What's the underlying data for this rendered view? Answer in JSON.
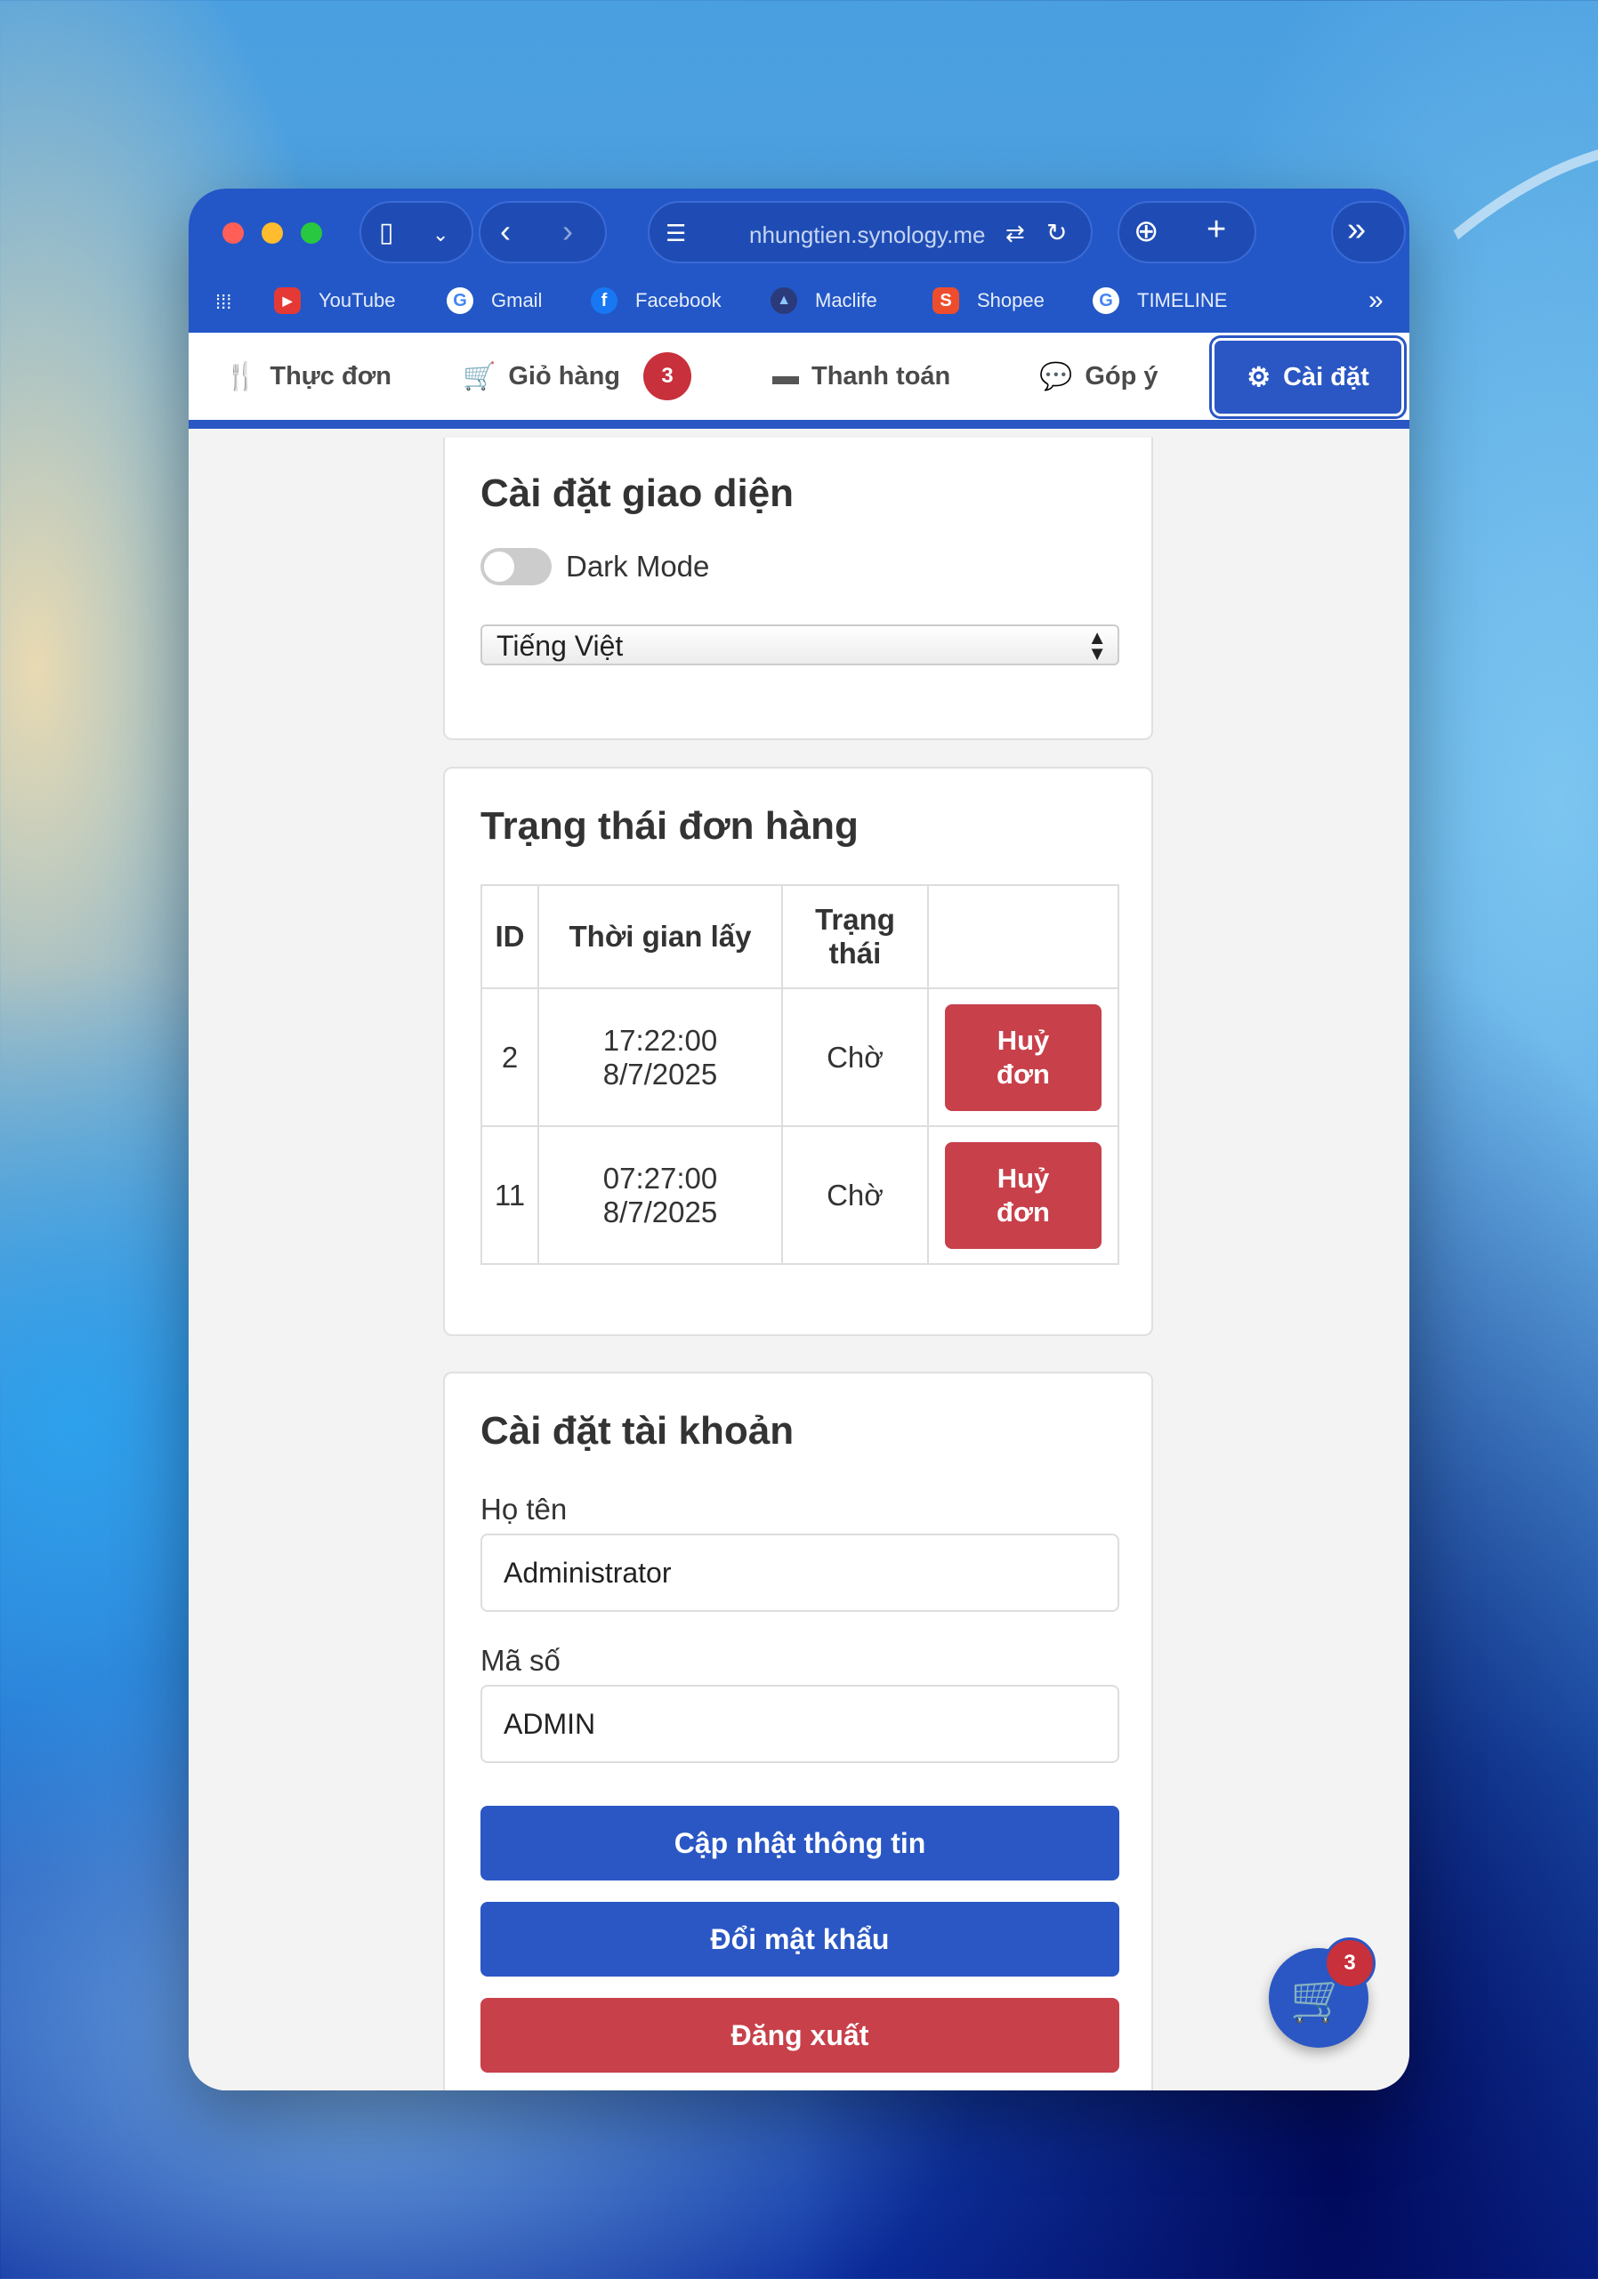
{
  "browser": {
    "url": "nhungtien.synology.me",
    "bookmarks": [
      {
        "label": "YouTube",
        "icon": "youtube-icon",
        "color": "#e53935"
      },
      {
        "label": "Gmail",
        "icon": "google-icon",
        "color": "#ffffff"
      },
      {
        "label": "Facebook",
        "icon": "facebook-icon",
        "color": "#1877f2"
      },
      {
        "label": "Maclife",
        "icon": "maclife-icon",
        "color": "#2b3a7a"
      },
      {
        "label": "Shopee",
        "icon": "shopee-icon",
        "color": "#ee4d2d"
      },
      {
        "label": "TIMELINE",
        "icon": "google-icon",
        "color": "#ffffff"
      }
    ]
  },
  "nav": {
    "menu": "Thực đơn",
    "cart": "Giỏ hàng",
    "cart_count": "3",
    "payment": "Thanh toán",
    "feedback": "Góp ý",
    "settings": "Cài đặt"
  },
  "ui_settings": {
    "title": "Cài đặt giao diện",
    "dark_mode_label": "Dark Mode",
    "dark_mode_on": false,
    "language": "Tiếng Việt"
  },
  "orders": {
    "title": "Trạng thái đơn hàng",
    "headers": {
      "id": "ID",
      "time": "Thời gian lấy",
      "status_1": "Trạng",
      "status_2": "thái"
    },
    "rows": [
      {
        "id": "2",
        "time": "17:22:00",
        "date": "8/7/2025",
        "status": "Chờ",
        "cancel_1": "Huỷ",
        "cancel_2": "đơn"
      },
      {
        "id": "11",
        "time": "07:27:00",
        "date": "8/7/2025",
        "status": "Chờ",
        "cancel_1": "Huỷ",
        "cancel_2": "đơn"
      }
    ]
  },
  "account": {
    "title": "Cài đặt tài khoản",
    "name_label": "Họ tên",
    "name_value": "Administrator",
    "code_label": "Mã số",
    "code_value": "ADMIN",
    "update_button": "Cập nhật thông tin",
    "password_button": "Đổi mật khẩu",
    "logout_button": "Đăng xuất"
  },
  "floating_cart": {
    "count": "3"
  },
  "colors": {
    "primary": "#2a57c4",
    "danger": "#c8404a",
    "badge": "#c8303b"
  }
}
